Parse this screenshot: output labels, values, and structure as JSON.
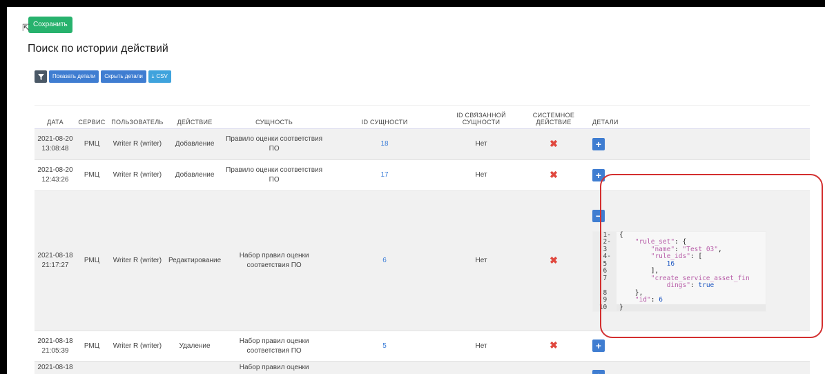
{
  "save_label": "Сохранить",
  "page_title": "Поиск по истории действий",
  "toolbar": {
    "filter_icon": "filter-icon",
    "show_details": "Показать детали",
    "hide_details": "Скрыть детали",
    "csv": "CSV",
    "csv_icon": "download-icon"
  },
  "table": {
    "headers": {
      "date": "ДАТА",
      "service": "СЕРВИС",
      "user": "ПОЛЬЗОВАТЕЛЬ",
      "action": "ДЕЙСТВИЕ",
      "entity": "СУЩНОСТЬ",
      "entity_id": "ID СУЩНОСТИ",
      "related_id_1": "ID СВЯЗАННОЙ",
      "related_id_2": "СУЩНОСТИ",
      "system_1": "СИСТЕМНОЕ",
      "system_2": "ДЕЙСТВИЕ",
      "details": "ДЕТАЛИ"
    },
    "rows": [
      {
        "date": "2021-08-20",
        "time": "13:08:48",
        "service": "РМЦ",
        "user": "Writer R (writer)",
        "action": "Добавление",
        "entity_1": "Правило оценки соответствия",
        "entity_2": "ПО",
        "entity_id": "18",
        "related": "Нет"
      },
      {
        "date": "2021-08-20",
        "time": "12:43:26",
        "service": "РМЦ",
        "user": "Writer R (writer)",
        "action": "Добавление",
        "entity_1": "Правило оценки соответствия",
        "entity_2": "ПО",
        "entity_id": "17",
        "related": "Нет"
      },
      {
        "date": "2021-08-18",
        "time": "21:17:27",
        "service": "РМЦ",
        "user": "Writer R (writer)",
        "action": "Редактирование",
        "entity_1": "Набор правил оценки",
        "entity_2": "соответствия ПО",
        "entity_id": "6",
        "related": "Нет"
      },
      {
        "date": "2021-08-18",
        "time": "21:05:39",
        "service": "РМЦ",
        "user": "Writer R (writer)",
        "action": "Удаление",
        "entity_1": "Набор правил оценки",
        "entity_2": "соответствия ПО",
        "entity_id": "5",
        "related": "Нет"
      },
      {
        "date": "2021-08-18",
        "entity_1": "Набор правил оценки"
      }
    ]
  },
  "json_lines": [
    {
      "n": "1",
      "fold": "-",
      "text": "{"
    },
    {
      "n": "2",
      "fold": "-",
      "key": "\"rule_set\"",
      "rest": ": {",
      "indent": 1
    },
    {
      "n": "3",
      "fold": "",
      "key": "\"name\"",
      "rest": ": ",
      "str": "\"Test 03\"",
      "tail": ",",
      "indent": 2
    },
    {
      "n": "4",
      "fold": "-",
      "key": "\"rule_ids\"",
      "rest": ": [",
      "indent": 2
    },
    {
      "n": "5",
      "fold": "",
      "num": "16",
      "indent": 3
    },
    {
      "n": "6",
      "fold": "",
      "text": "],",
      "indent": 2
    },
    {
      "n": "7",
      "fold": "",
      "key": "\"create_service_asset_fin",
      "indent": 2
    },
    {
      "n": "",
      "fold": "",
      "key": "dings\"",
      "rest": ": ",
      "bool": "true",
      "indent": 3
    },
    {
      "n": "8",
      "fold": "",
      "text": "},",
      "indent": 1
    },
    {
      "n": "9",
      "fold": "",
      "key": "\"id\"",
      "rest": ": ",
      "num": "6",
      "indent": 1
    },
    {
      "n": "10",
      "fold": "",
      "text": "}"
    }
  ],
  "colors": {
    "save": "#27b26d",
    "primary": "#3f7dd1",
    "csv": "#3fa3dd",
    "filter": "#4a5866",
    "red_x": "#e0483e",
    "annotation": "#d32f2f"
  }
}
